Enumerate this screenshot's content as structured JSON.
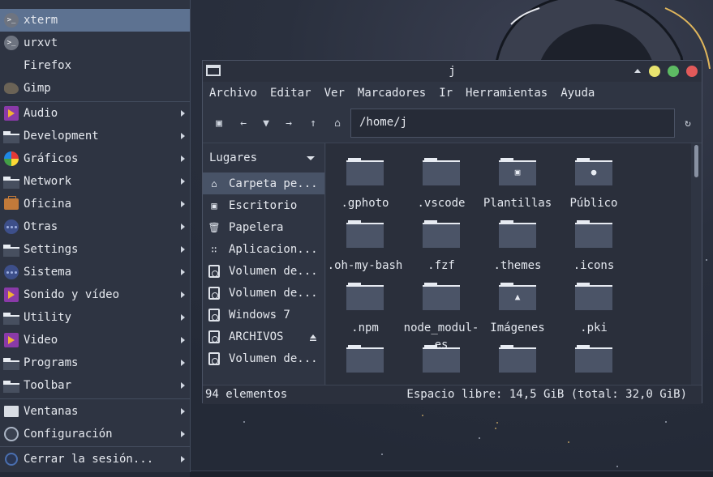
{
  "menu": {
    "items": [
      {
        "label": "xterm",
        "icon": "terminal-icon",
        "submenu": false,
        "selected": true
      },
      {
        "label": "urxvt",
        "icon": "terminal-icon",
        "submenu": false
      },
      {
        "label": "Firefox",
        "icon": "firefox-icon",
        "submenu": false
      },
      {
        "label": "Gimp",
        "icon": "gimp-icon",
        "submenu": false
      },
      {
        "label": "Audio",
        "icon": "multimedia-icon",
        "submenu": true
      },
      {
        "label": "Development",
        "icon": "folder-icon",
        "submenu": true
      },
      {
        "label": "Gráficos",
        "icon": "graphics-icon",
        "submenu": true
      },
      {
        "label": "Network",
        "icon": "folder-icon",
        "submenu": true
      },
      {
        "label": "Oficina",
        "icon": "office-icon",
        "submenu": true
      },
      {
        "label": "Otras",
        "icon": "other-icon",
        "submenu": true
      },
      {
        "label": "Settings",
        "icon": "folder-icon",
        "submenu": true
      },
      {
        "label": "Sistema",
        "icon": "system-icon",
        "submenu": true
      },
      {
        "label": "Sonido y vídeo",
        "icon": "multimedia-icon",
        "submenu": true
      },
      {
        "label": "Utility",
        "icon": "folder-icon",
        "submenu": true
      },
      {
        "label": "Video",
        "icon": "multimedia-icon",
        "submenu": true
      },
      {
        "label": "Programs",
        "icon": "folder-icon",
        "submenu": true
      },
      {
        "label": "Toolbar",
        "icon": "folder-icon",
        "submenu": true
      }
    ],
    "bottom": [
      {
        "label": "Ventanas",
        "icon": "window-icon",
        "submenu": true
      },
      {
        "label": "Configuración",
        "icon": "settings-icon",
        "submenu": true
      },
      {
        "label": "Cerrar la sesión...",
        "icon": "logout-icon",
        "submenu": true
      }
    ]
  },
  "filemanager": {
    "title": "j",
    "menubar": [
      "Archivo",
      "Editar",
      "Ver",
      "Marcadores",
      "Ir",
      "Herramientas",
      "Ayuda"
    ],
    "location": "/home/j",
    "sidebar": {
      "header": "Lugares",
      "items": [
        {
          "label": "Carpeta pe...",
          "icon": "home-icon",
          "active": true
        },
        {
          "label": "Escritorio",
          "icon": "desktop-icon"
        },
        {
          "label": "Papelera",
          "icon": "trash-icon"
        },
        {
          "label": "Aplicacion...",
          "icon": "applications-icon"
        },
        {
          "label": "Volumen de...",
          "icon": "drive-icon"
        },
        {
          "label": "Volumen de...",
          "icon": "drive-icon"
        },
        {
          "label": "Windows 7",
          "icon": "drive-icon"
        },
        {
          "label": "ARCHIVOS",
          "icon": "drive-icon",
          "eject": true
        },
        {
          "label": "Volumen de...",
          "icon": "drive-icon"
        }
      ]
    },
    "files": [
      {
        "name": ".gphoto",
        "emblem": ""
      },
      {
        "name": ".vscode",
        "emblem": ""
      },
      {
        "name": "Plantillas",
        "emblem": "template"
      },
      {
        "name": "Público",
        "emblem": "user"
      },
      {
        "name": ".oh-my-bash",
        "emblem": ""
      },
      {
        "name": ".fzf",
        "emblem": ""
      },
      {
        "name": ".themes",
        "emblem": ""
      },
      {
        "name": ".icons",
        "emblem": ""
      },
      {
        "name": ".npm",
        "emblem": ""
      },
      {
        "name": "node_modul-",
        "name2": "es",
        "emblem": ""
      },
      {
        "name": "Imágenes",
        "emblem": "image"
      },
      {
        "name": ".pki",
        "emblem": ""
      },
      {
        "name": "",
        "emblem": ""
      },
      {
        "name": "",
        "emblem": ""
      },
      {
        "name": "",
        "emblem": ""
      },
      {
        "name": "",
        "emblem": ""
      }
    ],
    "status": {
      "count": "94 elementos",
      "free": "Espacio libre: 14,5 GiB (total: 32,0 GiB)"
    },
    "colors": {
      "close": "#e25a5a",
      "maximize": "#5dbb63",
      "minimize": "#e8e36f"
    }
  }
}
